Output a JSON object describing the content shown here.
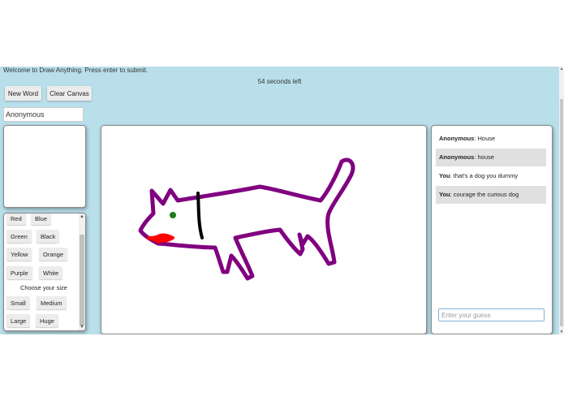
{
  "header": {
    "welcome": "Welcome to Draw Anything. Press enter to submit.",
    "timer": "54 seconds left"
  },
  "toolbar": {
    "new_word": "New Word",
    "clear_canvas": "Clear Canvas"
  },
  "user": {
    "name": "Anonymous"
  },
  "palette": {
    "colors": [
      "Red",
      "Blue",
      "Green",
      "Black",
      "Yellow",
      "Orange",
      "Purple",
      "White"
    ],
    "size_label": "Choose your size",
    "sizes": [
      "Small",
      "Medium",
      "Large",
      "Huge"
    ]
  },
  "chat": {
    "messages": [
      {
        "author": "Anonymous",
        "text": ": House"
      },
      {
        "author": "Anonymous",
        "text": ": house"
      },
      {
        "author": "You",
        "text": ": that's a dog you dummy"
      },
      {
        "author": "You",
        "text": ": courage the curious dog"
      }
    ],
    "guess_placeholder": "Enter your guess"
  },
  "drawing": {
    "subject_icon": "dog-drawing",
    "colors": {
      "body": "#800080",
      "collar": "#000000",
      "eye": "#1e7e1e",
      "mouth": "#ff0000"
    }
  }
}
